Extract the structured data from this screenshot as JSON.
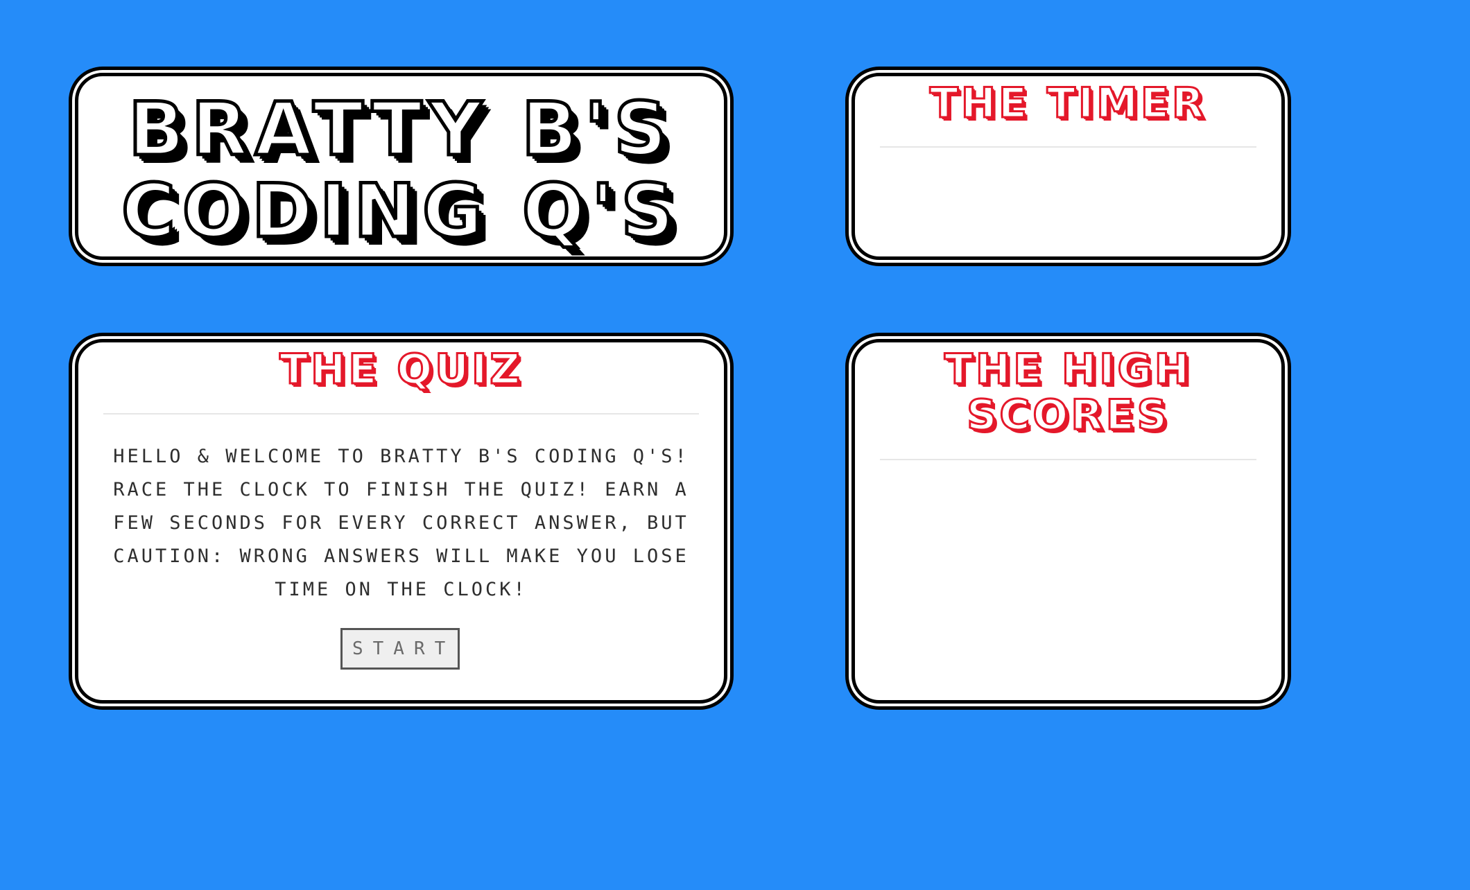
{
  "title": {
    "line1": "BRATTY B'S",
    "line2": "CODING Q'S"
  },
  "timer": {
    "heading": "THE TIMER"
  },
  "quiz": {
    "heading": "THE QUIZ",
    "intro": "Hello & welcome to Bratty B's Coding Q's! Race the clock to finish the quiz! Earn a few seconds for every correct answer, but caution: wrong answers will make you lose time on the clock!",
    "start_label": "START"
  },
  "scores": {
    "heading_line1": "THE HIGH",
    "heading_line2": "SCORES"
  },
  "colors": {
    "background": "#258cf9",
    "card": "#ffffff",
    "border": "#000000",
    "heading_accent": "#e4182a"
  }
}
